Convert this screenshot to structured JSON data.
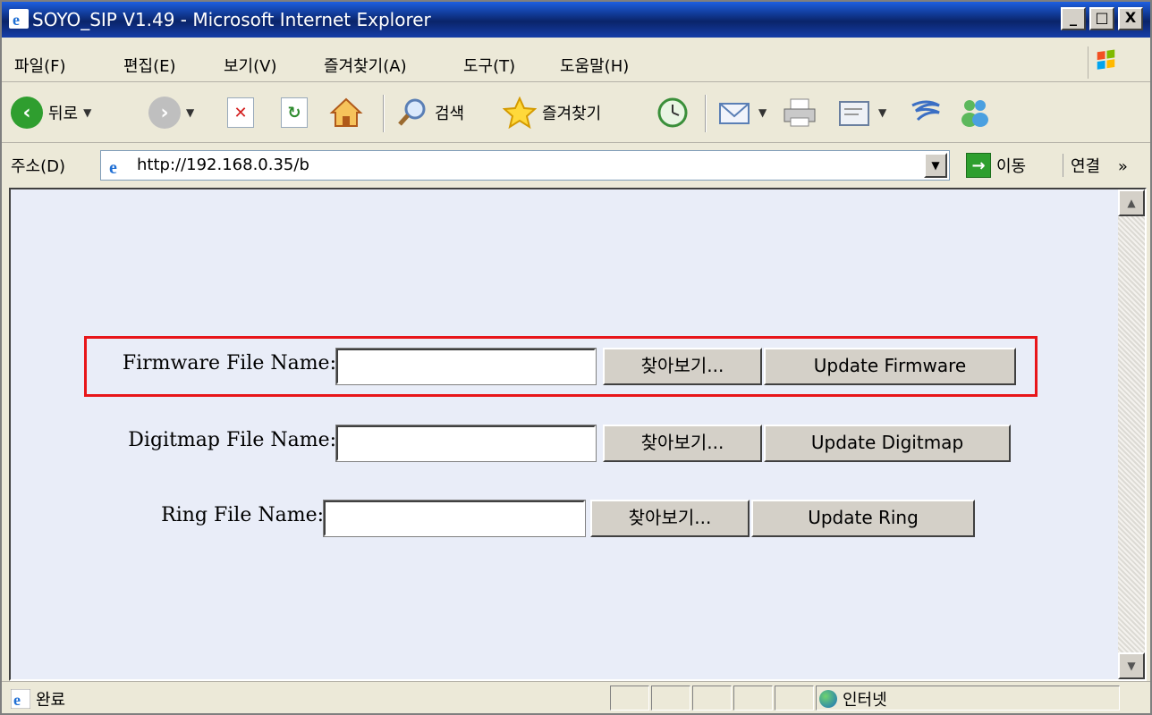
{
  "window": {
    "title": "SOYO_SIP V1.49 - Microsoft Internet Explorer",
    "controls": {
      "minimize": "_",
      "maximize": "□",
      "close": "X"
    }
  },
  "menubar": {
    "items": [
      {
        "label": "파일(F)"
      },
      {
        "label": "편집(E)"
      },
      {
        "label": "보기(V)"
      },
      {
        "label": "즐겨찾기(A)"
      },
      {
        "label": "도구(T)"
      },
      {
        "label": "도움말(H)"
      }
    ]
  },
  "toolbar": {
    "back_label": "뒤로",
    "search_label": "검색",
    "favorites_label": "즐겨찾기"
  },
  "address": {
    "label": "주소(D)",
    "url": "http://192.168.0.35/b",
    "go_label": "이동",
    "links_label": "연결",
    "links_chevron": "»"
  },
  "form": {
    "rows": [
      {
        "label": "Firmware File Name:",
        "value": "",
        "browse_label": "찾아보기...",
        "action_label": "Update Firmware"
      },
      {
        "label": "Digitmap File Name:",
        "value": "",
        "browse_label": "찾아보기...",
        "action_label": "Update Digitmap"
      },
      {
        "label": "Ring File Name:",
        "value": "",
        "browse_label": "찾아보기...",
        "action_label": "Update Ring"
      }
    ]
  },
  "status": {
    "text": "완료",
    "zone": "인터넷"
  },
  "colors": {
    "title_bar": "#0a246a",
    "content_background": "#e9edf8",
    "highlight_border": "#e8161a"
  },
  "icons": [
    "ie-icon",
    "windows-logo-icon",
    "back-icon",
    "forward-icon",
    "stop-icon",
    "refresh-icon",
    "home-icon",
    "search-icon",
    "favorites-star-icon",
    "history-icon",
    "mail-icon",
    "print-icon",
    "edit-icon",
    "messenger-icon",
    "go-arrow-icon",
    "globe-icon"
  ]
}
